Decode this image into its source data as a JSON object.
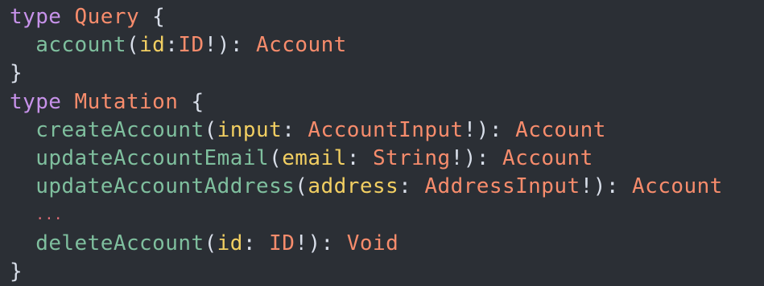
{
  "code": {
    "line1": {
      "kw": "type",
      "name": "Query",
      "open": "{"
    },
    "line2": {
      "fn": "account",
      "paren_open": "(",
      "arg": "id",
      "colon": ":",
      "type": "ID",
      "bang": "!",
      "paren_close": ")",
      "sep": ":",
      "ret": "Account"
    },
    "line3": {
      "close": "}"
    },
    "line4": {
      "kw": "type",
      "name": "Mutation",
      "open": "{"
    },
    "line5": {
      "fn": "createAccount",
      "paren_open": "(",
      "arg": "input",
      "colon": ":",
      "type": "AccountInput",
      "bang": "!",
      "paren_close": ")",
      "sep": ":",
      "ret": "Account"
    },
    "line6": {
      "fn": "updateAccountEmail",
      "paren_open": "(",
      "arg": "email",
      "colon": ":",
      "type": "String",
      "bang": "!",
      "paren_close": ")",
      "sep": ":",
      "ret": "Account"
    },
    "line7": {
      "fn": "updateAccountAddress",
      "paren_open": "(",
      "arg": "address",
      "colon": ":",
      "type": "AddressInput",
      "bang": "!",
      "paren_close": ")",
      "sep": ":",
      "ret": "Account"
    },
    "line8": {
      "ellipsis": "..."
    },
    "line9": {
      "fn": "deleteAccount",
      "paren_open": "(",
      "arg": "id",
      "colon": ":",
      "type": "ID",
      "bang": "!",
      "paren_close": ")",
      "sep": ":",
      "ret": "Void"
    },
    "line10": {
      "close": "}"
    }
  },
  "colors": {
    "background": "#2b2f35",
    "keyword": "#c792ea",
    "type": "#f78c6c",
    "function": "#7fbf9e",
    "argument": "#f2cf62",
    "punctuation": "#d8dee9",
    "ellipsis": "#e06c75"
  }
}
